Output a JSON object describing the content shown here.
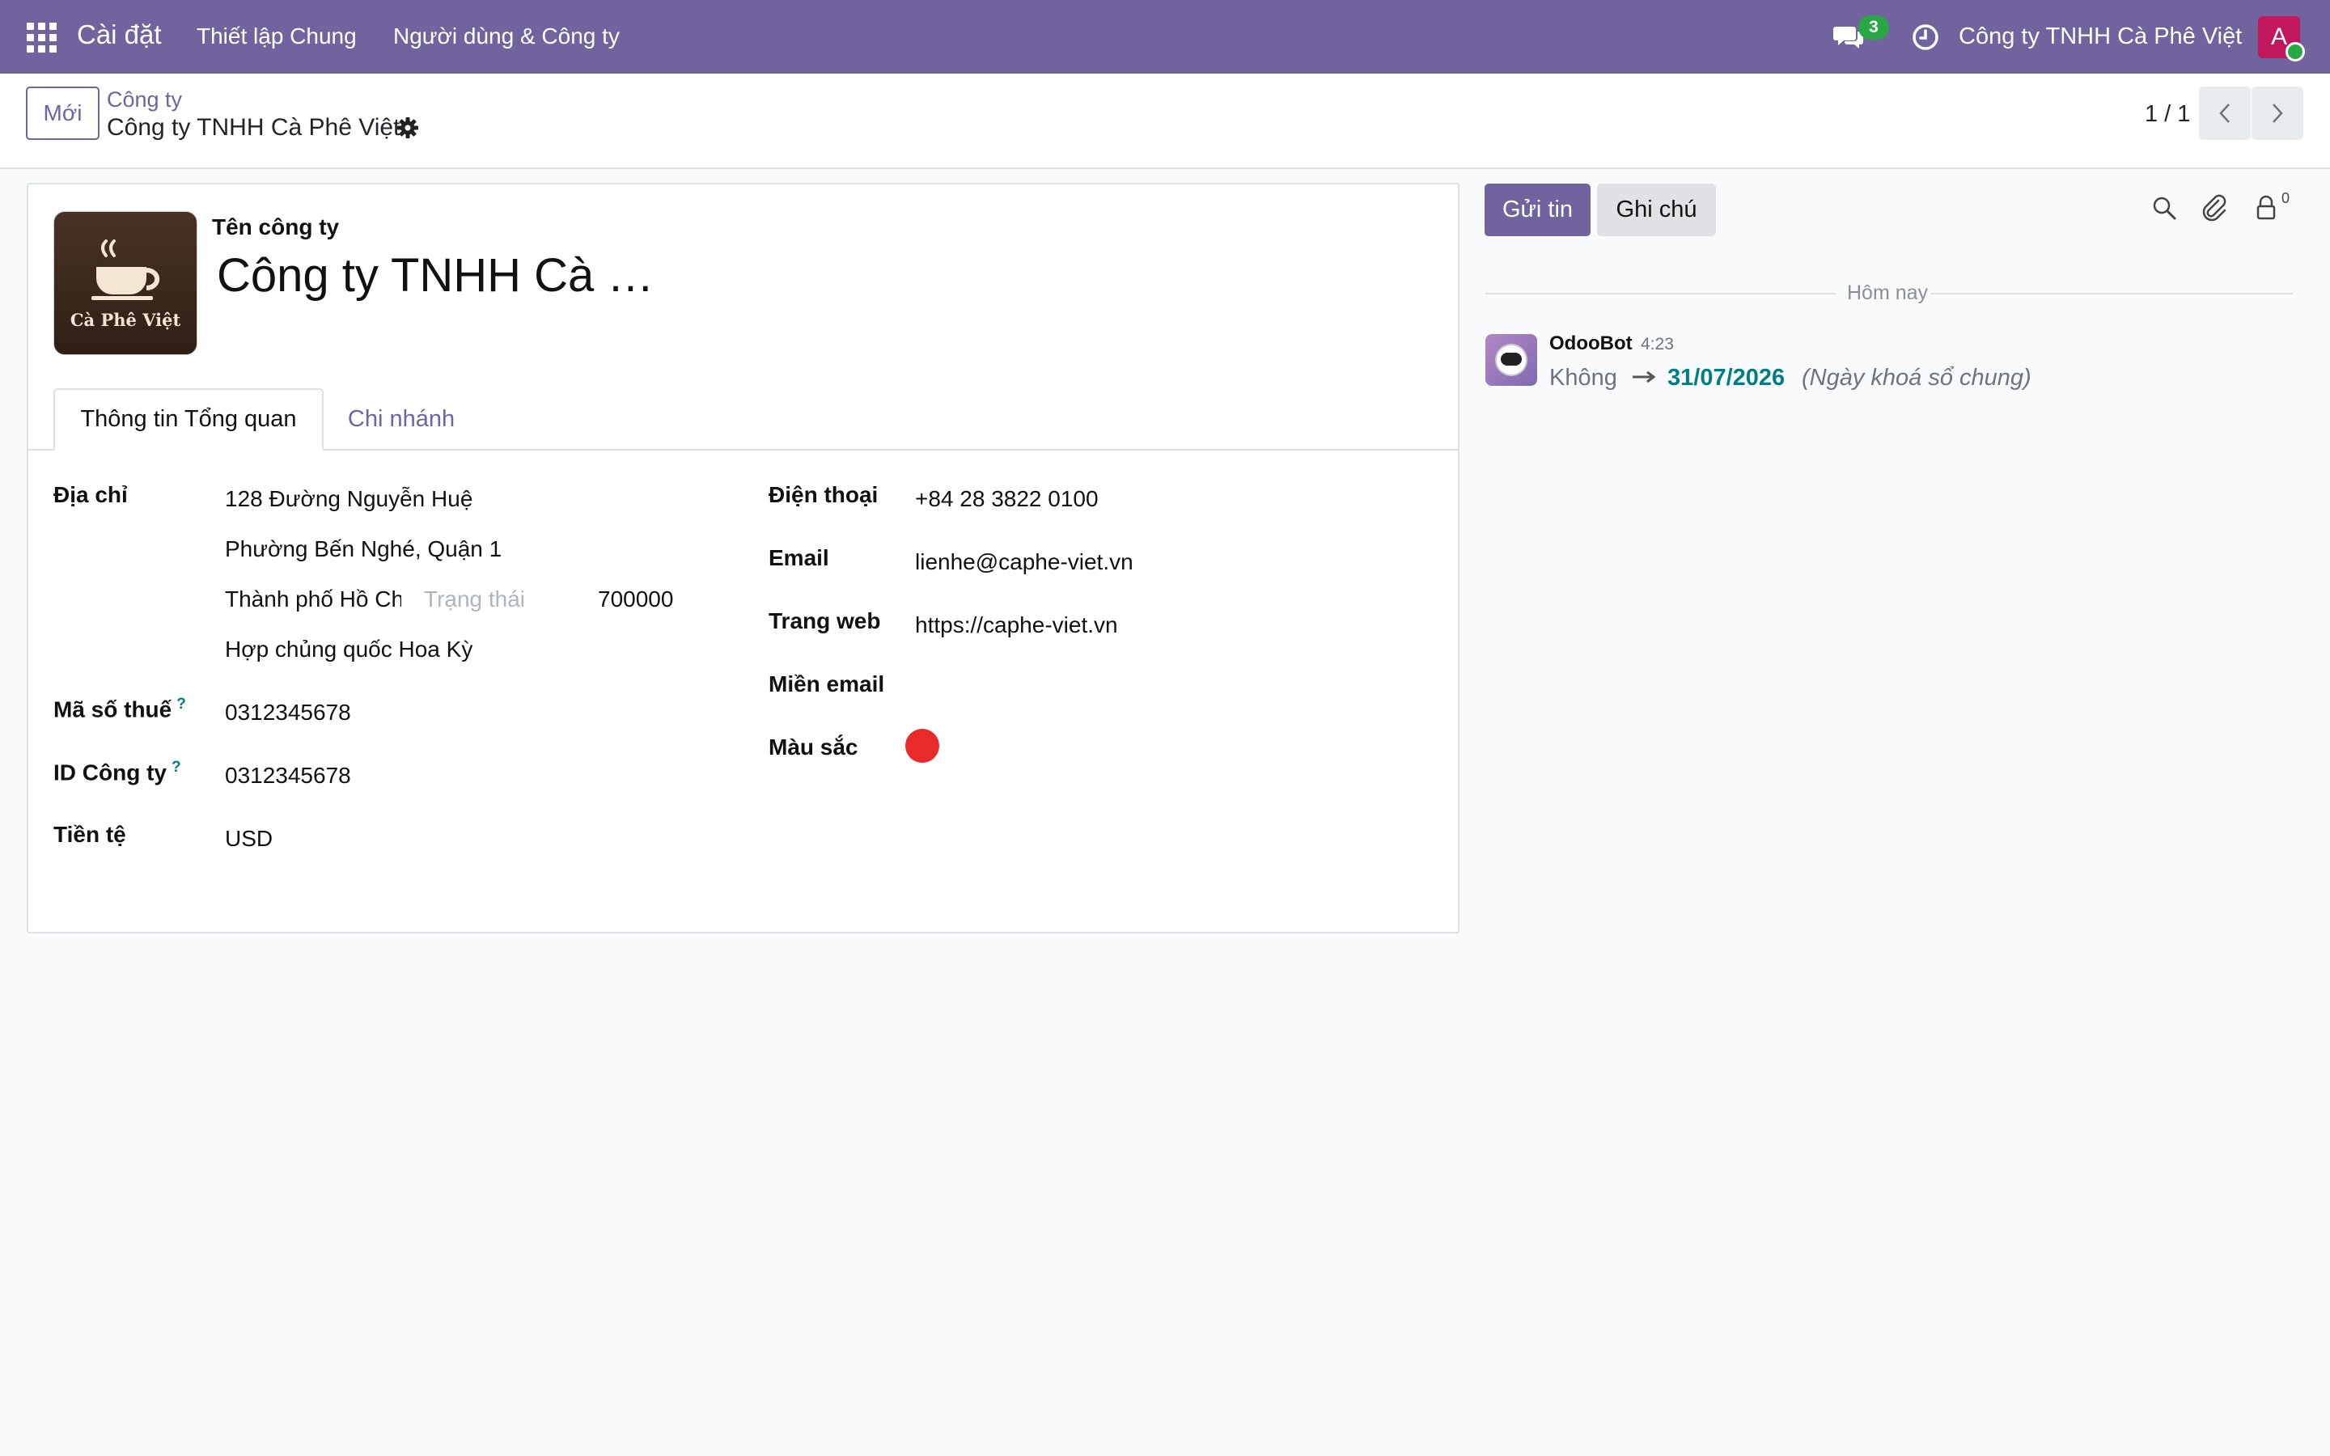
{
  "navbar": {
    "app_name": "Cài đặt",
    "menu": [
      "Thiết lập Chung",
      "Người dùng & Công ty"
    ],
    "messages_count": "3",
    "company_name": "Công ty TNHH Cà Phê Việt",
    "avatar_letter": "A",
    "bg_color": "#71639e"
  },
  "control_panel": {
    "new_button": "Mới",
    "breadcrumb_parent": "Công ty",
    "breadcrumb_current": "Công ty TNHH Cà Phê Việt",
    "pager": "1 / 1"
  },
  "form": {
    "logo_text": "Cà Phê Việt",
    "name_label": "Tên công ty",
    "name_value": "Công ty TNHH Cà Phê Việt",
    "tabs": [
      "Thông tin Tổng quan",
      "Chi nhánh"
    ],
    "address": {
      "label": "Địa chỉ",
      "street": "128 Đường Nguyễn Huệ",
      "street2": "Phường Bến Nghé, Quận 1",
      "city": "Thành phố Hồ Chí Minh",
      "state_placeholder": "Trạng thái",
      "zip": "700000",
      "country": "Hợp chủng quốc Hoa Kỳ"
    },
    "vat": {
      "label": "Mã số thuế",
      "help": "?",
      "value": "0312345678"
    },
    "company_id": {
      "label": "ID Công ty",
      "help": "?",
      "value": "0312345678"
    },
    "currency": {
      "label": "Tiền tệ",
      "value": "USD"
    },
    "phone": {
      "label": "Điện thoại",
      "value": "+84 28 3822 0100"
    },
    "email": {
      "label": "Email",
      "value": "lienhe@caphe-viet.vn"
    },
    "website": {
      "label": "Trang web",
      "value": "https://caphe-viet.vn"
    },
    "email_domain": {
      "label": "Miền email",
      "value": ""
    },
    "color": {
      "label": "Màu sắc",
      "value": "#e82a2a"
    }
  },
  "chatter": {
    "send_button": "Gửi tin",
    "note_button": "Ghi chú",
    "followers_count": "0",
    "date_separator": "Hôm nay",
    "message": {
      "author": "OdooBot",
      "time": "4:23",
      "old_value": "Không",
      "new_value": "31/07/2026",
      "field": "(Ngày khoá sổ chung)"
    }
  }
}
